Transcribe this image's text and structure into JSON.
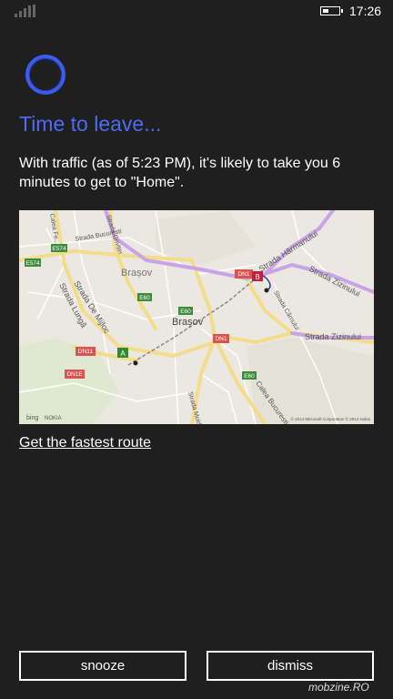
{
  "status": {
    "time": "17:26"
  },
  "card": {
    "title": "Time to leave...",
    "message": "With traffic (as of 5:23 PM), it's likely to take you 6 minutes to get to \"Home\".",
    "route_link": "Get the fastest route"
  },
  "map": {
    "labels": {
      "brasov_top": "Brașov",
      "brasov_center": "Brașov",
      "strada_harmanului": "Strada Hărmanului",
      "strada_zizinului_1": "Strada Zizinului",
      "strada_zizinului_2": "Strada Zizinului",
      "strada_lunga": "Strada Lungă",
      "strada_de_mijloc": "Strada De Mijloc",
      "strada_bucuresti": "Strada Bucuresti",
      "strada_grivitei": "Strada Griviței",
      "calea_fe": "Calea Fe...",
      "calea_bucuresti": "Calea Bucuresti",
      "strada_carnului": "Strada Cărnului",
      "strada_moldoului": "Strada Moldoului",
      "road_e574a": "E574",
      "road_e574b": "E574",
      "road_e60a": "E60",
      "road_e60b": "E60",
      "road_e60c": "E60",
      "road_dn1a": "DN1",
      "road_dn1b": "DN1",
      "road_dn11": "DN11",
      "road_dn1e": "DN1E",
      "pin_a": "A",
      "pin_b": "B",
      "bing": "bing",
      "nokia": "NOKIA",
      "copyright": "© 2014 Microsoft Corporation  © 2014 Nokia"
    }
  },
  "buttons": {
    "snooze": "snooze",
    "dismiss": "dismiss"
  },
  "watermark": "mobzine.RO",
  "colors": {
    "accent": "#4c6cf0",
    "background": "#1f1f1f",
    "route": "#b089d6",
    "pin_a": "#2e8b2e",
    "pin_b": "#c0203a"
  }
}
